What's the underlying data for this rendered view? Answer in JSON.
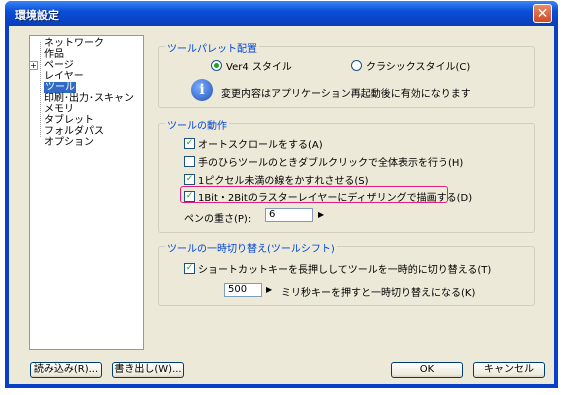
{
  "window": {
    "title": "環境設定",
    "close_glyph": "✕"
  },
  "tree": {
    "items": [
      {
        "label": "ネットワーク",
        "expandable": false
      },
      {
        "label": "作品",
        "expandable": false
      },
      {
        "label": "ページ",
        "expandable": true,
        "expander_glyph": "+"
      },
      {
        "label": "レイヤー",
        "expandable": false
      },
      {
        "label": "ツール",
        "expandable": false,
        "selected": true
      },
      {
        "label": "印刷･出力･スキャン",
        "expandable": false
      },
      {
        "label": "メモリ",
        "expandable": false
      },
      {
        "label": "タブレット",
        "expandable": false
      },
      {
        "label": "フォルダパス",
        "expandable": false
      },
      {
        "label": "オプション",
        "expandable": false
      }
    ]
  },
  "palette_group": {
    "title": "ツールパレット配置",
    "radio_ver4": "Ver4 スタイル",
    "radio_classic": "クラシックスタイル(C)",
    "selected": "ver4",
    "note": "変更内容はアプリケーション再起動後に有効になります"
  },
  "behavior_group": {
    "title": "ツールの動作",
    "checks": [
      {
        "label": "オートスクロールをする(A)",
        "checked": true
      },
      {
        "label": "手のひらツールのときダブルクリックで全体表示を行う(H)",
        "checked": false
      },
      {
        "label": "1ピクセル未満の線をかすれさせる(S)",
        "checked": true
      },
      {
        "label": "1Bit・2Bitのラスターレイヤーにディザリングで描画する(D)",
        "checked": true,
        "highlighted": true
      }
    ],
    "pen_weight_label": "ペンの重さ(P):",
    "pen_weight_value": "6"
  },
  "shift_group": {
    "title": "ツールの一時切り替え(ツールシフト)",
    "check_label": "ショートカットキーを長押ししてツールを一時的に切り替える(T)",
    "checked": true,
    "ms_value": "500",
    "ms_label": "ミリ秒キーを押すと一時切り替えになる(K)"
  },
  "buttons": {
    "import": "読み込み(R)...",
    "export": "書き出し(W)...",
    "ok": "OK",
    "cancel": "キャンセル"
  },
  "glyphs": {
    "check": "✓",
    "arrow_right": "▶",
    "info": "i"
  },
  "colors": {
    "title_bar": "#0b4fd8",
    "dialog_bg": "#ece9d8",
    "group_title": "#0046d5",
    "highlight": "#e0207a",
    "selection": "#316ac5"
  }
}
